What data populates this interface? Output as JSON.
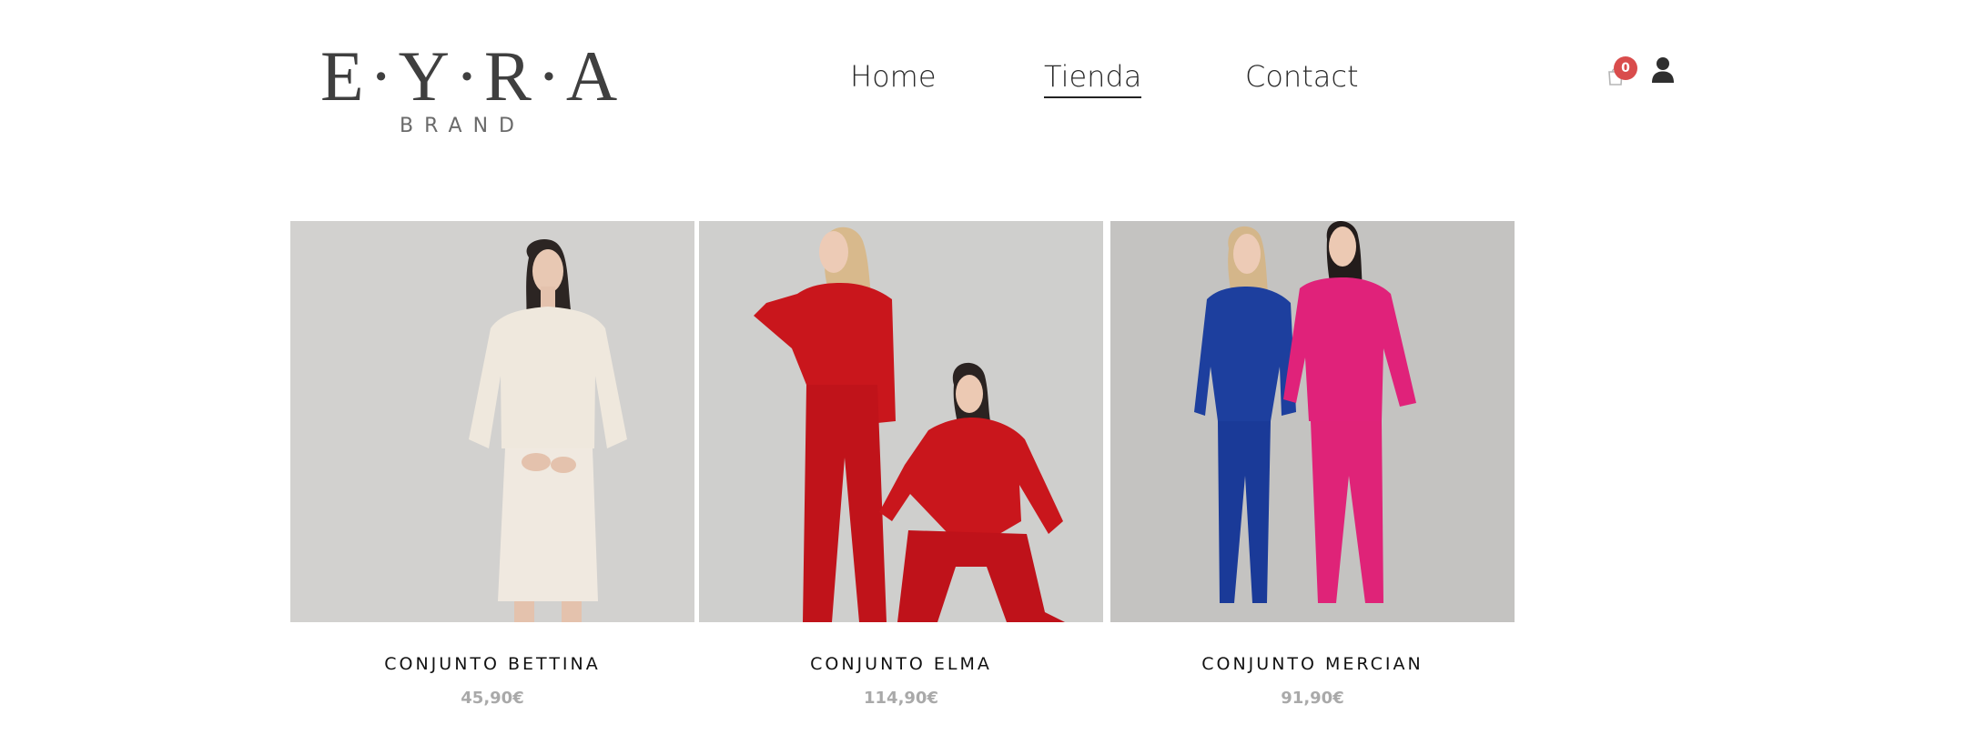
{
  "brand": {
    "name": "E·Y·R·A",
    "tagline": "BRAND"
  },
  "nav": {
    "items": [
      {
        "label": "Home"
      },
      {
        "label": "Tienda"
      },
      {
        "label": "Contact"
      }
    ],
    "active": "Tienda"
  },
  "cart": {
    "count": "0",
    "icon": "cart-icon"
  },
  "account": {
    "icon": "user-icon"
  },
  "products": [
    {
      "name": "CONJUNTO BETTINA",
      "price": "45,90€"
    },
    {
      "name": "CONJUNTO ELMA",
      "price": "114,90€"
    },
    {
      "name": "CONJUNTO MERCIAN",
      "price": "91,90€"
    }
  ],
  "colors": {
    "badge": "#d94c4c",
    "price": "#a9a9a9",
    "text": "#111111"
  }
}
